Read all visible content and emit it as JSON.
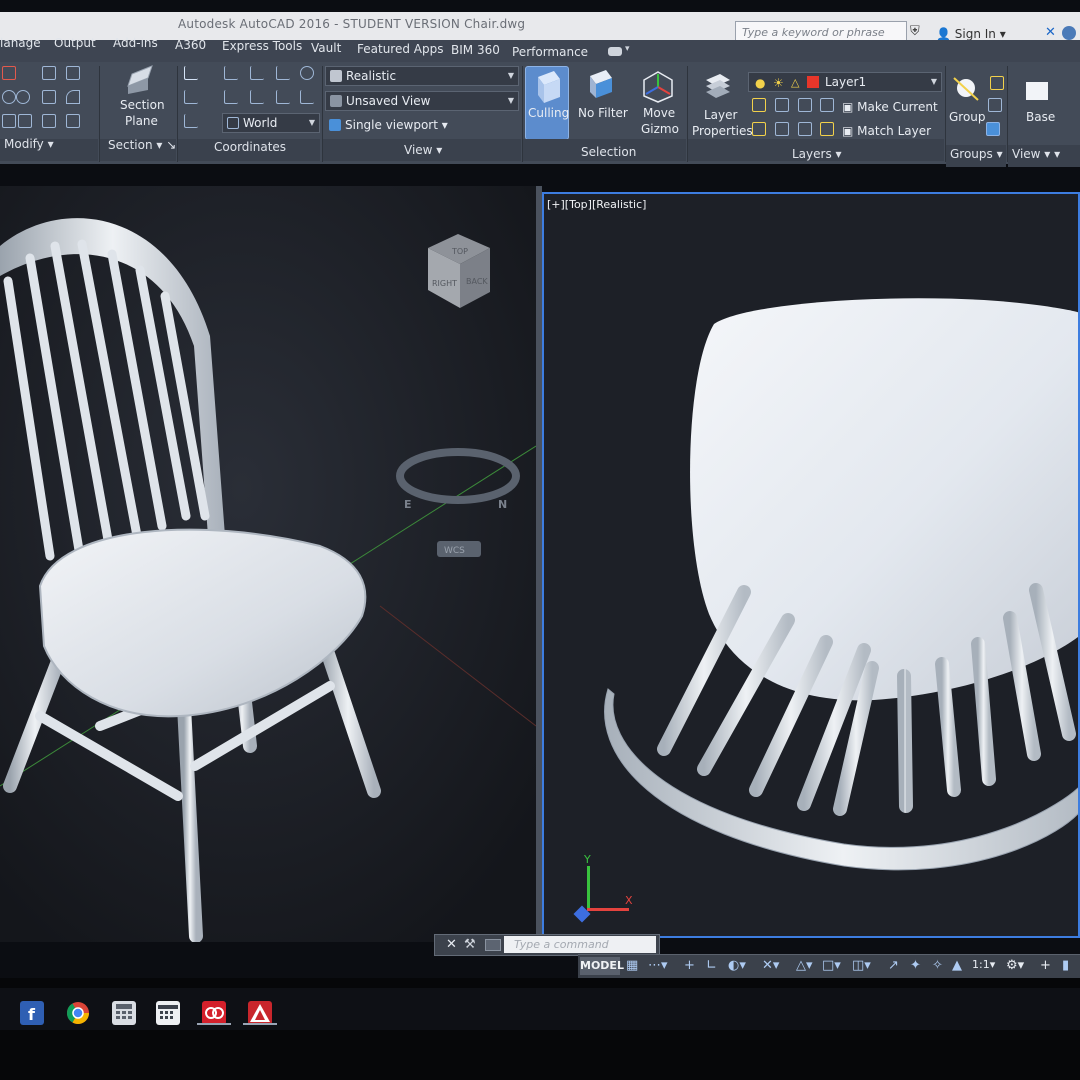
{
  "window": {
    "title": "Autodesk AutoCAD 2016 - STUDENT VERSION    Chair.dwg",
    "search_placeholder": "Type a keyword or phrase",
    "sign_in": "Sign In"
  },
  "menu": [
    "lanage",
    "Output",
    "Add-ins",
    "A360",
    "Express Tools",
    "Vault",
    "Featured Apps",
    "BIM 360",
    "Performance"
  ],
  "ribbon": {
    "section_plane": [
      "Section",
      "Plane"
    ],
    "visual_style": "Realistic",
    "saved_view": "Unsaved View",
    "viewport_config": "Single viewport",
    "ucs": "World",
    "culling": "Culling",
    "no_filter": "No Filter",
    "move_gizmo": [
      "Move",
      "Gizmo"
    ],
    "layer_properties": [
      "Layer",
      "Properties"
    ],
    "layer_name": "Layer1",
    "make_current": "Make Current",
    "match_layer": "Match Layer",
    "group": "Group",
    "base": "Base",
    "panels": {
      "modify": "Modify",
      "section": "Section",
      "coordinates": "Coordinates",
      "view": "View",
      "selection": "Selection",
      "layers": "Layers",
      "groups": "Groups",
      "view2": "View"
    }
  },
  "viewports": {
    "right_label": "[+][Top][Realistic]"
  },
  "viewcube": {
    "faces": [
      "TOP",
      "RIGHT",
      "BACK"
    ],
    "compass": [
      "E",
      "N"
    ],
    "wcs": "WCS"
  },
  "ucs_icon": {
    "y": "Y",
    "x": "X"
  },
  "command": {
    "placeholder": "Type a command"
  },
  "status": {
    "model": "MODEL",
    "scale": "1:1"
  },
  "colors": {
    "accent": "#3d7de0",
    "layer_color": "#e8362a"
  }
}
